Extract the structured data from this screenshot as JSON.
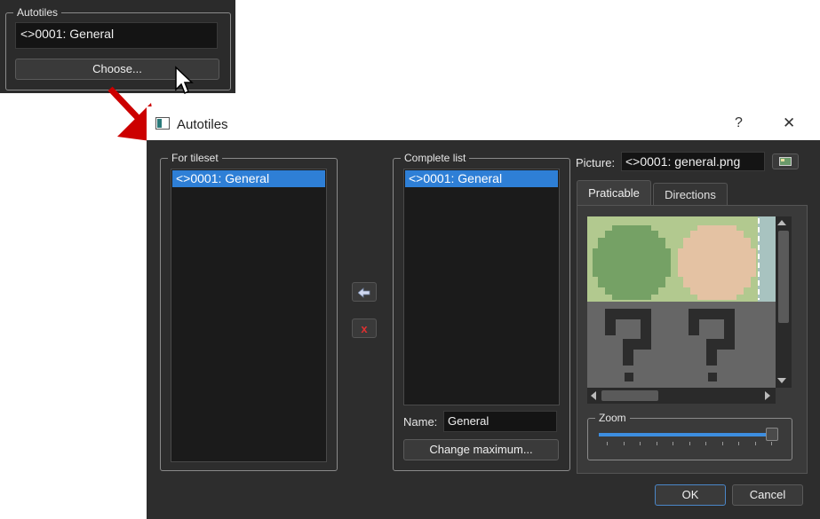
{
  "snippet": {
    "group_title": "Autotiles",
    "field_value": "<>0001: General",
    "choose_label": "Choose..."
  },
  "dialog": {
    "title": "Autotiles",
    "help_label": "?",
    "close_label": "✕",
    "for_tileset": {
      "title": "For tileset",
      "items": [
        "<>0001: General"
      ]
    },
    "complete_list": {
      "title": "Complete list",
      "items": [
        "<>0001: General"
      ],
      "name_label": "Name:",
      "name_value": "General",
      "change_max_label": "Change maximum..."
    },
    "picture": {
      "label": "Picture:",
      "value": "<>0001: general.png"
    },
    "tabs": [
      "Praticable",
      "Directions"
    ],
    "active_tab": "Praticable",
    "zoom": {
      "title": "Zoom",
      "level_fraction": 1.0
    },
    "ok_label": "OK",
    "cancel_label": "Cancel"
  },
  "colors": {
    "selection": "#2e7fd6",
    "dialog_bg": "#2d2d2d",
    "delete_x": "#e03030",
    "arrow": "#cc0000"
  },
  "icons": [
    "cursor-icon",
    "arrow-pointer-icon",
    "window-icon",
    "help-icon",
    "close-icon",
    "add-left-arrow-icon",
    "delete-x-icon",
    "image-browse-icon"
  ]
}
